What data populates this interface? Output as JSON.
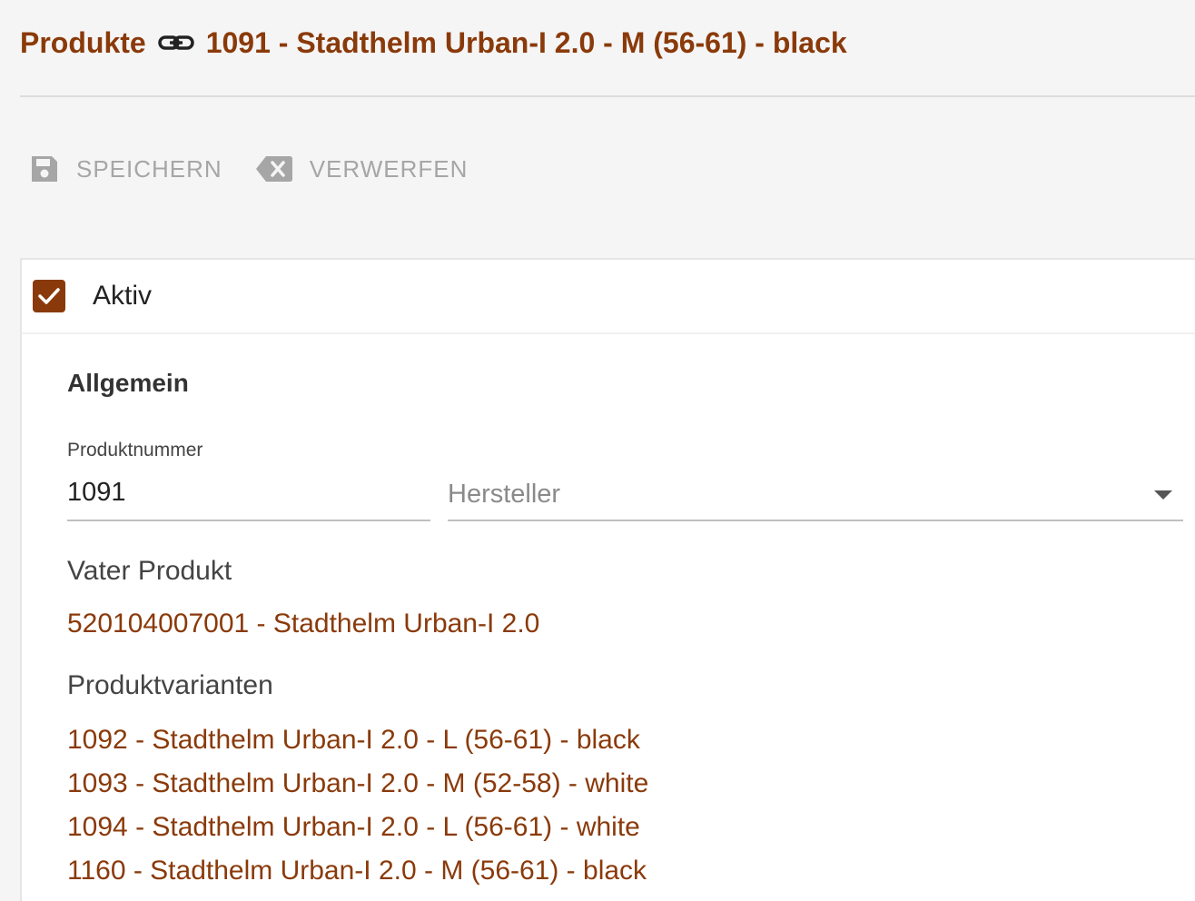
{
  "header": {
    "breadcrumb_root": "Produkte",
    "record_title": "1091 - Stadthelm Urban-I 2.0 - M (56-61) - black",
    "link_icon": "link-icon"
  },
  "toolbar": {
    "save_label": "SPEICHERN",
    "save_icon": "floppy-disk-icon",
    "discard_label": "VERWERFEN",
    "discard_icon": "backspace-icon"
  },
  "form": {
    "active_label": "Aktiv",
    "active_checked": true,
    "section_title": "Allgemein",
    "product_number_label": "Produktnummer",
    "product_number_value": "1091",
    "manufacturer_placeholder": "Hersteller",
    "parent_label": "Vater Produkt",
    "parent_value": "520104007001 - Stadthelm Urban-I 2.0",
    "variants_label": "Produktvarianten",
    "variants": [
      "1092 - Stadthelm Urban-I 2.0 - L (56-61) - black",
      "1093 - Stadthelm Urban-I 2.0 - M (52-58) - white",
      "1094 - Stadthelm Urban-I 2.0 - L (56-61) - white",
      "1160 - Stadthelm Urban-I 2.0 - M (56-61) - black"
    ]
  },
  "colors": {
    "accent": "#8a3a0a",
    "disabled_text": "#a6a6a6",
    "background": "#f5f5f5"
  }
}
